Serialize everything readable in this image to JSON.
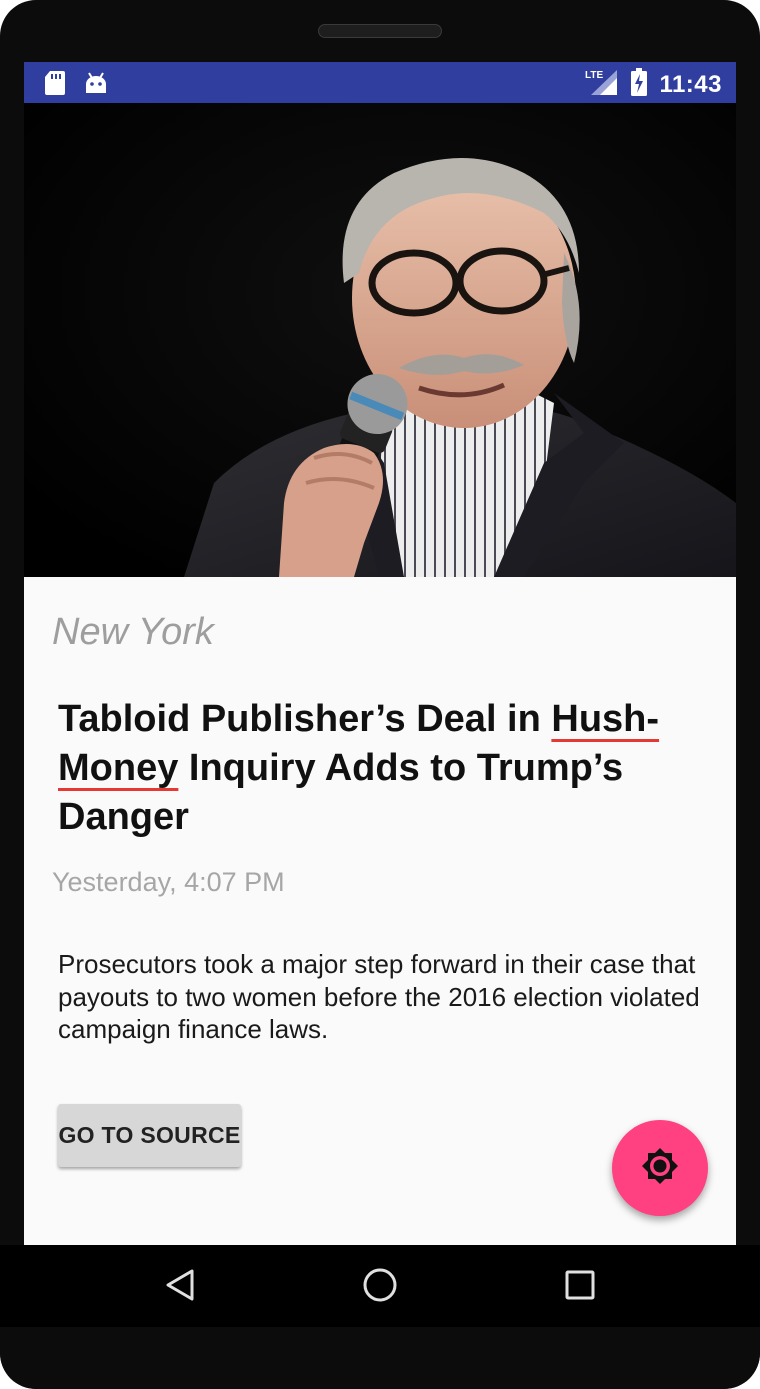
{
  "status_bar": {
    "time": "11:43",
    "network": "LTE",
    "icons": [
      "sd-card-icon",
      "android-icon",
      "lte-signal-icon",
      "battery-charging-icon"
    ],
    "color": "#303f9f"
  },
  "article": {
    "location": "New York",
    "headline_parts": {
      "before": "Tabloid Publisher’s Deal in ",
      "word1": "Hush-",
      "word2": "Money",
      "after": " Inquiry Adds to Trump’s Danger"
    },
    "timestamp": "Yesterday, 4:07 PM",
    "summary": "Prosecutors took a major step forward in their case that payouts to two women before the 2016 election violated campaign finance laws.",
    "source_button_label": "GO TO SOURCE",
    "image_icon": "photo-of-man-speaking-into-microphone"
  },
  "fab": {
    "icon": "brightness-settings-icon",
    "color": "#ff4081"
  },
  "nav_bar": {
    "icons": [
      "back-icon",
      "home-icon",
      "recents-icon"
    ]
  }
}
